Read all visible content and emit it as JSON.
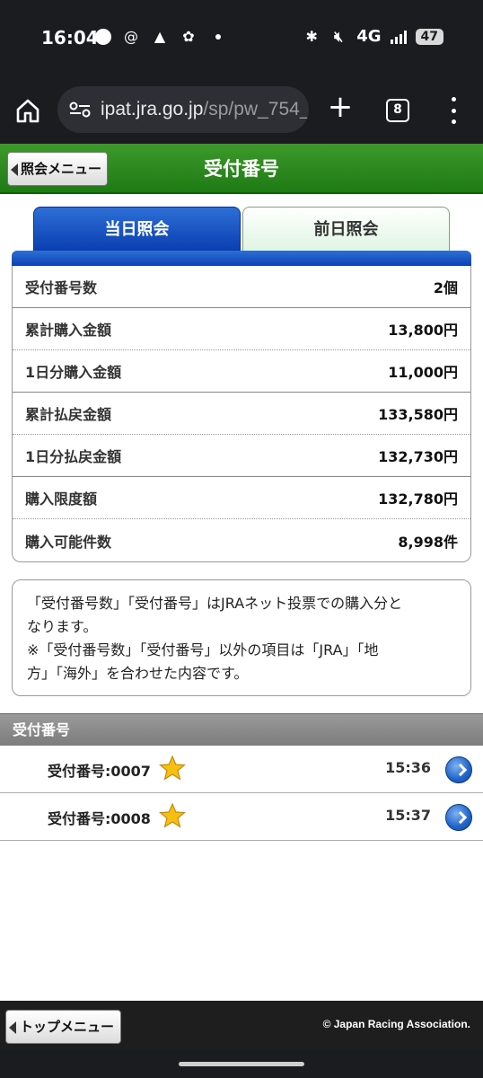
{
  "status_bar": {
    "time": "16:04",
    "network": "4G",
    "battery": "47",
    "icons": [
      "whatsapp-icon",
      "threads-icon",
      "netkeiba-icon",
      "pinwheel-icon",
      "bluetooth-icon",
      "mute-icon",
      "signal-icon"
    ]
  },
  "browser": {
    "url_host": "ipat.jra.go.jp",
    "url_path": "/sp/pw_754_",
    "tab_count": "8"
  },
  "header": {
    "back_label": "照会メニュー",
    "title": "受付番号"
  },
  "tabs": [
    {
      "label": "当日照会",
      "active": true
    },
    {
      "label": "前日照会",
      "active": false
    }
  ],
  "summary": [
    {
      "label": "受付番号数",
      "value": "2個"
    },
    {
      "label": "累計購入金額",
      "value": "13,800円"
    },
    {
      "label": "1日分購入金額",
      "value": "11,000円"
    },
    {
      "label": "累計払戻金額",
      "value": "133,580円"
    },
    {
      "label": "1日分払戻金額",
      "value": "132,730円"
    },
    {
      "label": "購入限度額",
      "value": "132,780円"
    },
    {
      "label": "購入可能件数",
      "value": "8,998件"
    }
  ],
  "note": {
    "line1": "「受付番号数」「受付番号」はJRAネット投票での購入分と",
    "line2": "なります。",
    "line3": "※「受付番号数」「受付番号」以外の項目は「JRA」「地",
    "line4": "方」「海外」を合わせた内容です。"
  },
  "section": {
    "title": "受付番号"
  },
  "receipts": [
    {
      "label": "受付番号:0007",
      "time": "15:36"
    },
    {
      "label": "受付番号:0008",
      "time": "15:37"
    }
  ],
  "footer": {
    "top_label": "トップメニュー",
    "copyright": "© Japan Racing Association."
  },
  "colors": {
    "header_green": "#2a8a1e",
    "tab_blue": "#1a55c4",
    "footer_dark": "#1e1e1e"
  }
}
